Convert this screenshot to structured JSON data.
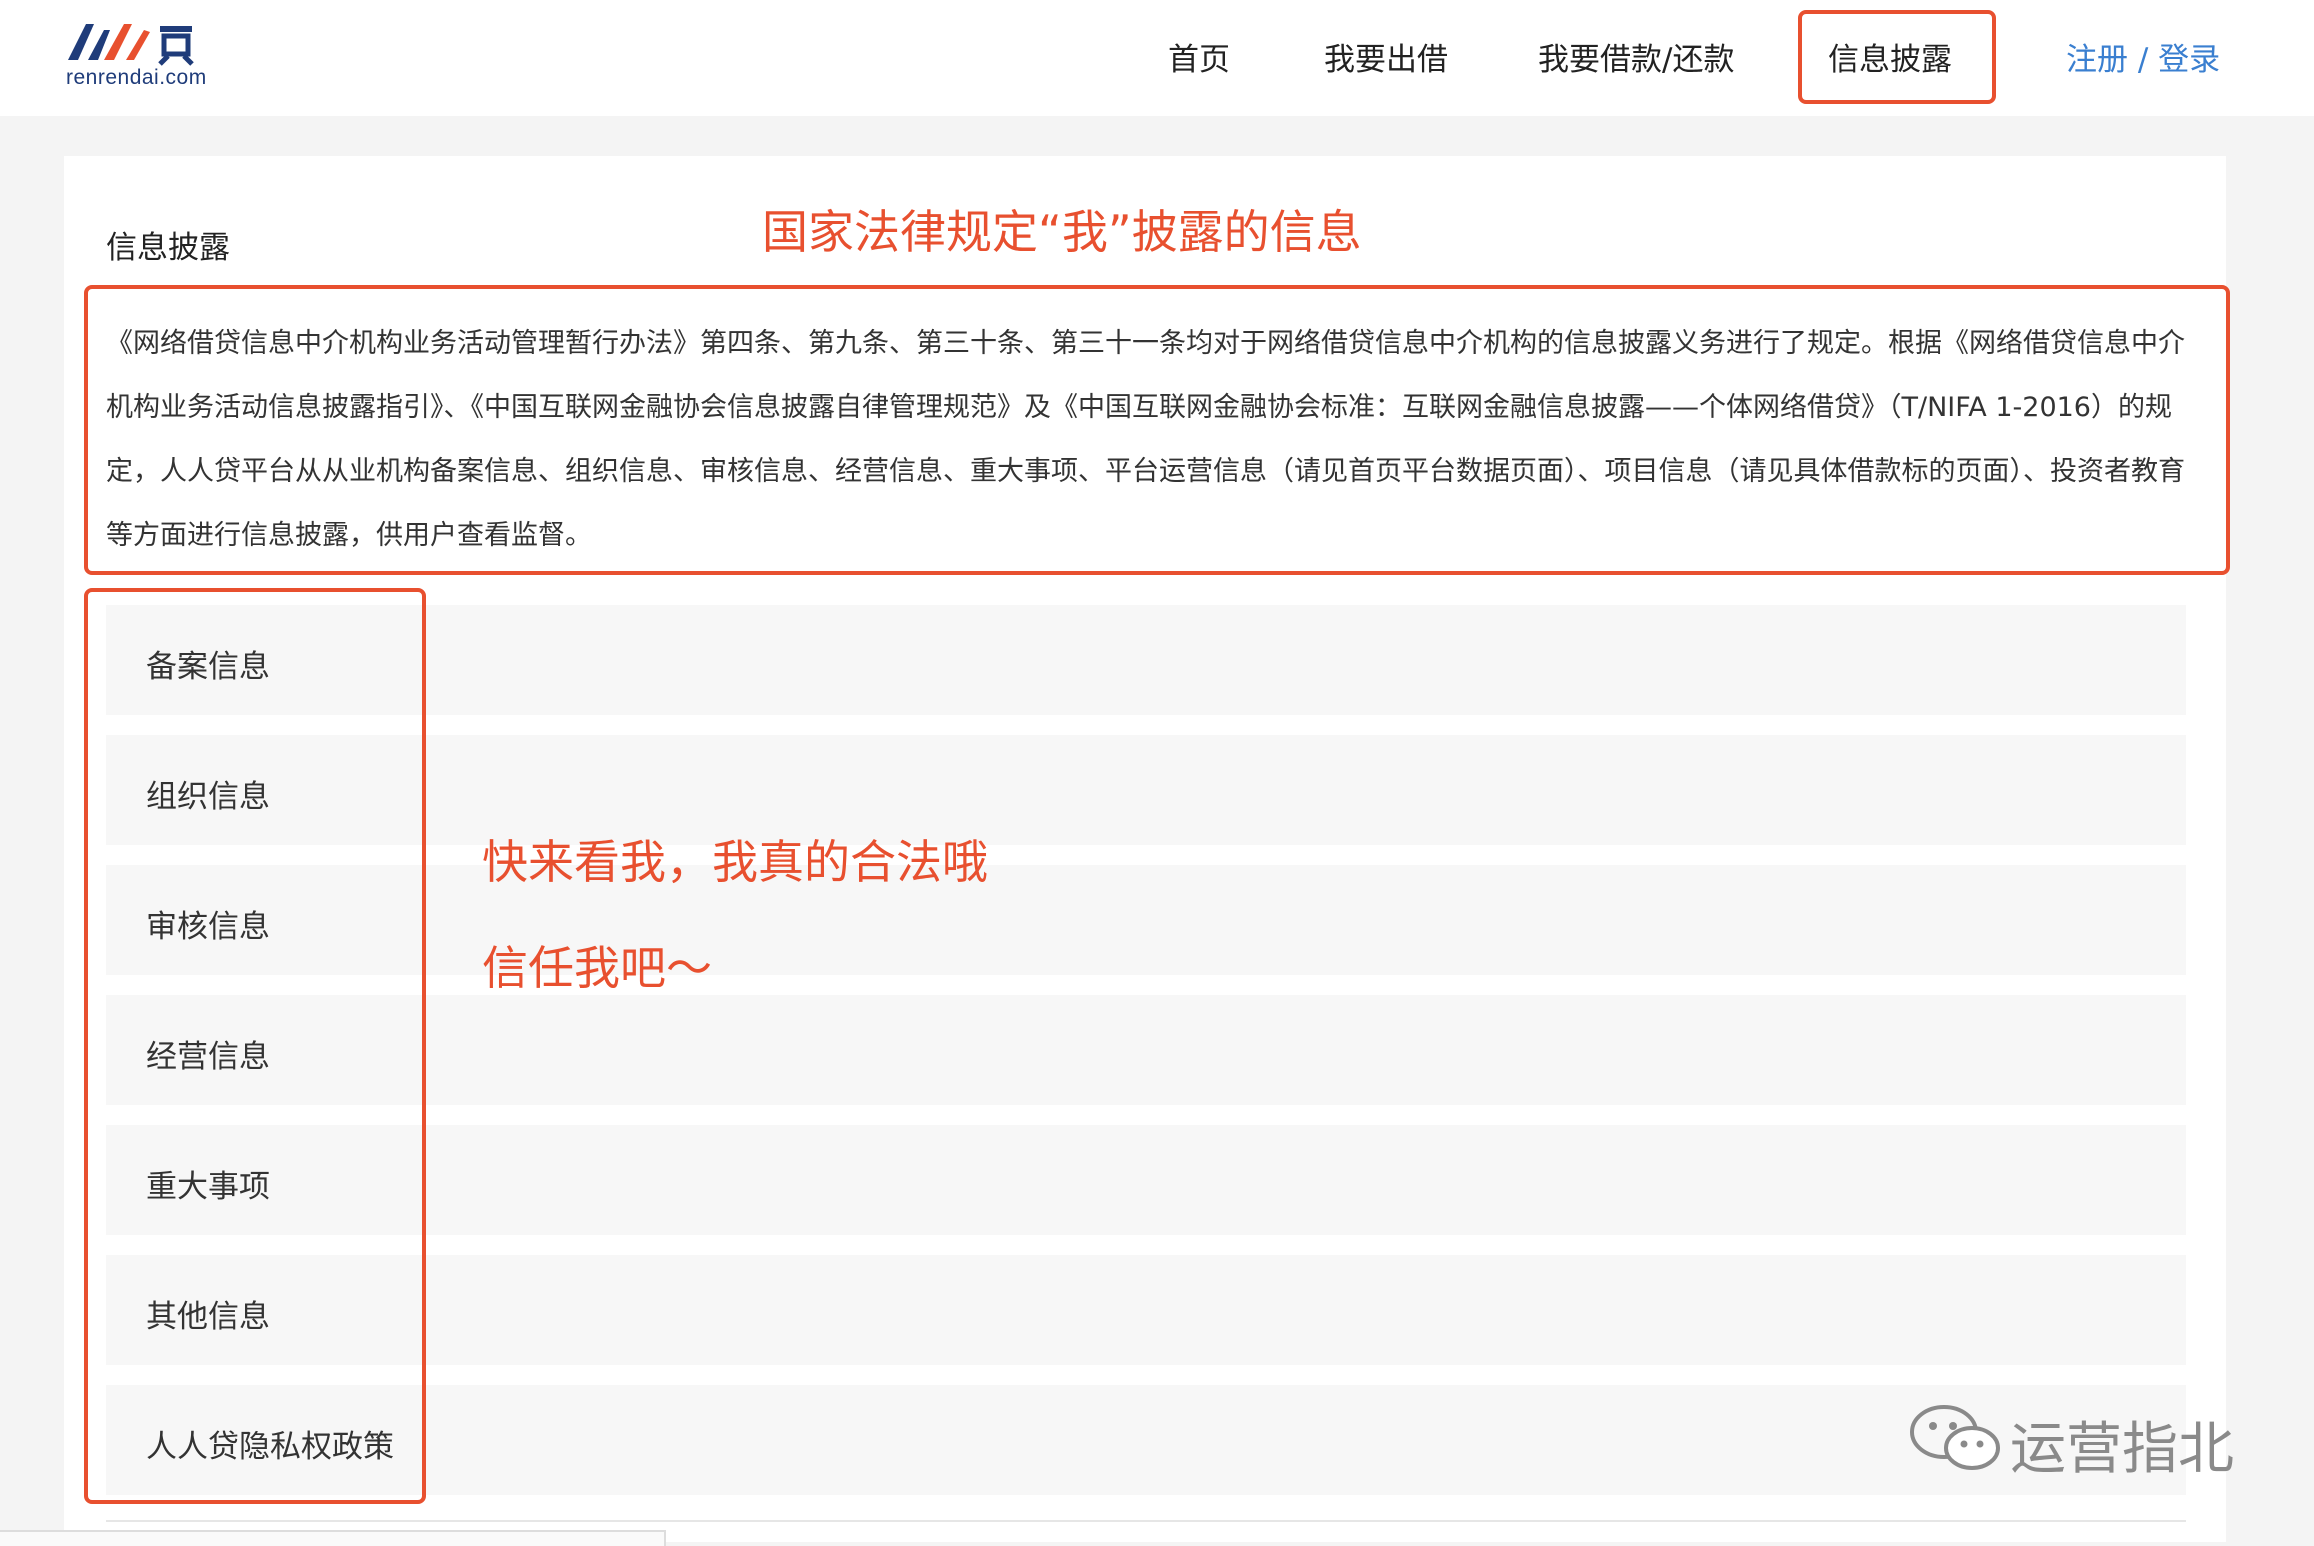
{
  "header": {
    "logo_domain": "renrendai.com",
    "nav": [
      {
        "label": "首页"
      },
      {
        "label": "我要出借"
      },
      {
        "label": "我要借款/还款"
      },
      {
        "label": "信息披露"
      }
    ],
    "active_nav": "信息披露",
    "auth": {
      "register": "注册",
      "separator": " / ",
      "login": "登录"
    }
  },
  "main": {
    "section_title": "信息披露",
    "intro": "《网络借贷信息中介机构业务活动管理暂行办法》第四条、第九条、第三十条、第三十一条均对于网络借贷信息中介机构的信息披露义务进行了规定。根据《网络借贷信息中介机构业务活动信息披露指引》、《中国互联网金融协会信息披露自律管理规范》及《中国互联网金融协会标准：互联网金融信息披露——个体网络借贷》（T/NIFA 1-2016）的规定，人人贷平台从从业机构备案信息、组织信息、审核信息、经营信息、重大事项、平台运营信息（请见首页平台数据页面）、项目信息（请见具体借款标的页面）、投资者教育等方面进行信息披露，供用户查看监督。",
    "items": [
      {
        "label": "备案信息"
      },
      {
        "label": "组织信息"
      },
      {
        "label": "审核信息"
      },
      {
        "label": "经营信息"
      },
      {
        "label": "重大事项"
      },
      {
        "label": "其他信息"
      },
      {
        "label": "人人贷隐私权政策"
      }
    ]
  },
  "annotations": {
    "headline": "国家法律规定“我”披露的信息",
    "line1": "快来看我，我真的合法哦",
    "line2": "信任我吧～"
  },
  "watermark": {
    "text": "运营指北",
    "icon": "wechat-icon"
  },
  "colors": {
    "accent_red": "#e8502f",
    "link_blue": "#3a7fd0",
    "logo_navy": "#1f3c7a"
  }
}
